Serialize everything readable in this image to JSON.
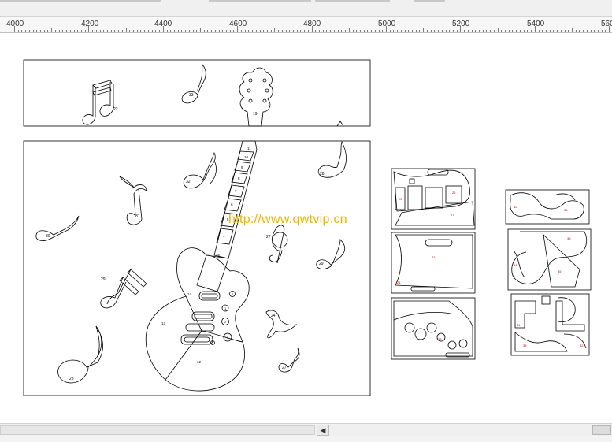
{
  "ruler": {
    "labels": [
      "4000",
      "4200",
      "4400",
      "4600",
      "4800",
      "5000",
      "5200",
      "5400",
      "560"
    ]
  },
  "watermark": {
    "text": "http://www.qwtvip.cn"
  },
  "guitar": {
    "fret_numbers": [
      "11",
      "10",
      "9",
      "8",
      "7",
      "6",
      "5",
      "4"
    ],
    "body_labels": [
      "14",
      "15",
      "13",
      "12"
    ],
    "knob_labels": [
      "1",
      "2",
      "3",
      "4"
    ],
    "headstock_label": "19"
  },
  "notes": {
    "labels": [
      "21",
      "22",
      "23",
      "24",
      "25",
      "26",
      "27",
      "28",
      "29",
      "30",
      "31",
      "32",
      "33",
      "34",
      "35",
      "36"
    ]
  },
  "colors": {
    "part_outline": "#000000",
    "label_red": "#d00000",
    "watermark": "#f2b400",
    "ruler_marker": "#4a90d9"
  },
  "hscroll": {
    "arrow_glyph": "◀"
  }
}
